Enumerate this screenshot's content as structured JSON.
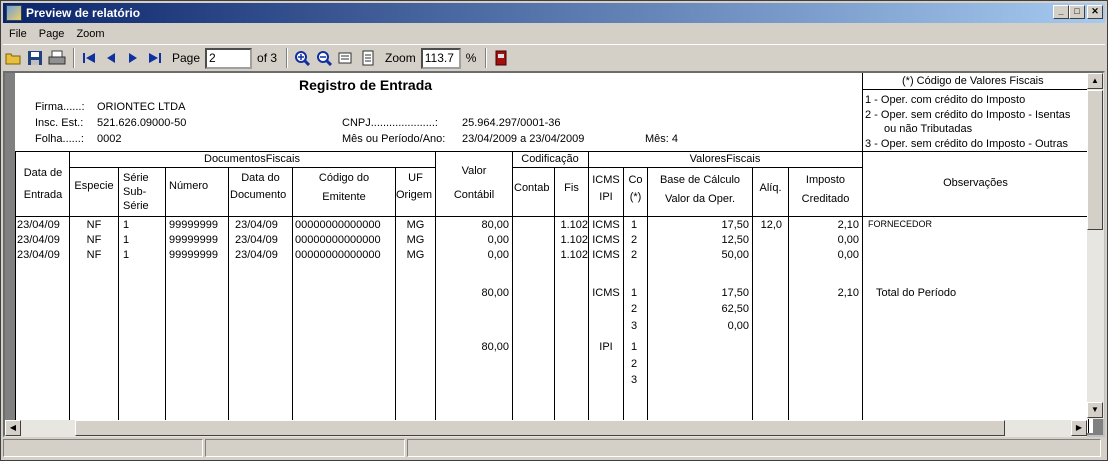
{
  "window": {
    "title": "Preview de relatório"
  },
  "menu": [
    "File",
    "Page",
    "Zoom"
  ],
  "toolbar": {
    "page_label": "Page",
    "page_value": "2",
    "of_label": "of 3",
    "zoom_label": "Zoom",
    "zoom_value": "113.7",
    "percent": "%"
  },
  "report": {
    "title": "Registro de Entrada",
    "firma_label": "Firma......:",
    "firma": "ORIONTEC  LTDA",
    "insc_label": "Insc. Est.:",
    "insc": "521.626.09000-50",
    "folha_label": "Folha......:",
    "folha": "0002",
    "cnpj_label": "CNPJ.....................:",
    "cnpj": "25.964.297/0001-36",
    "periodo_label": "Mês ou Período/Ano:",
    "periodo": "23/04/2009 a 23/04/2009",
    "mes": "Mês: 4",
    "legend_title": "(*) Código de Valores Fiscais",
    "legend": [
      "1 - Oper. com crédito do Imposto",
      "2 - Oper. sem crédito do Imposto - Isentas",
      "ou não Tributadas",
      "3 - Oper. sem crédito do Imposto - Outras"
    ],
    "headers": {
      "data_entrada_1": "Data de",
      "data_entrada_2": "Entrada",
      "docs_fiscais": "DocumentosFiscais",
      "especie": "Especie",
      "serie_1": "Série",
      "serie_2": "Sub-",
      "serie_3": "Série",
      "numero": "Número",
      "data_doc_1": "Data do",
      "data_doc_2": "Documento",
      "codigo_1": "Código do",
      "codigo_2": "Emitente",
      "uf_1": "UF",
      "uf_2": "Origem",
      "valor_1": "Valor",
      "valor_2": "Contábil",
      "codificacao": "Codificação",
      "contab": "Contab",
      "fis": "Fis",
      "valores_fiscais": "ValoresFiscais",
      "icms_ipi_1": "ICMS",
      "icms_ipi_2": "IPI",
      "co_1": "Co",
      "co_2": "(*)",
      "base_1": "Base de Cálculo",
      "base_2": "Valor da Oper.",
      "aliq": "Alíq.",
      "imposto_1": "Imposto",
      "imposto_2": "Creditado",
      "observacoes": "Observações"
    },
    "rows": [
      {
        "data": "23/04/09",
        "especie": "NF",
        "serie": "1",
        "numero": "99999999",
        "data_doc": "23/04/09",
        "codigo": "00000000000000",
        "uf": "MG",
        "valor": "80,00",
        "fis": "1.102",
        "imp": "ICMS",
        "co": "1",
        "base": "17,50",
        "aliq": "12,0",
        "imposto": "2,10",
        "obs": "FORNECEDOR"
      },
      {
        "data": "23/04/09",
        "especie": "NF",
        "serie": "1",
        "numero": "99999999",
        "data_doc": "23/04/09",
        "codigo": "00000000000000",
        "uf": "MG",
        "valor": "0,00",
        "fis": "1.102",
        "imp": "ICMS",
        "co": "2",
        "base": "12,50",
        "aliq": "",
        "imposto": "0,00",
        "obs": ""
      },
      {
        "data": "23/04/09",
        "especie": "NF",
        "serie": "1",
        "numero": "99999999",
        "data_doc": "23/04/09",
        "codigo": "00000000000000",
        "uf": "MG",
        "valor": "0,00",
        "fis": "1.102",
        "imp": "ICMS",
        "co": "2",
        "base": "50,00",
        "aliq": "",
        "imposto": "0,00",
        "obs": ""
      }
    ],
    "totals": {
      "icms_valor": "80,00",
      "icms_label": "ICMS",
      "icms_co": [
        "1",
        "2",
        "3"
      ],
      "icms_base": [
        "17,50",
        "62,50",
        "0,00"
      ],
      "icms_imposto": "2,10",
      "total_label": "Total do Período",
      "ipi_valor": "80,00",
      "ipi_label": "IPI",
      "ipi_co": [
        "1",
        "2",
        "3"
      ]
    }
  }
}
